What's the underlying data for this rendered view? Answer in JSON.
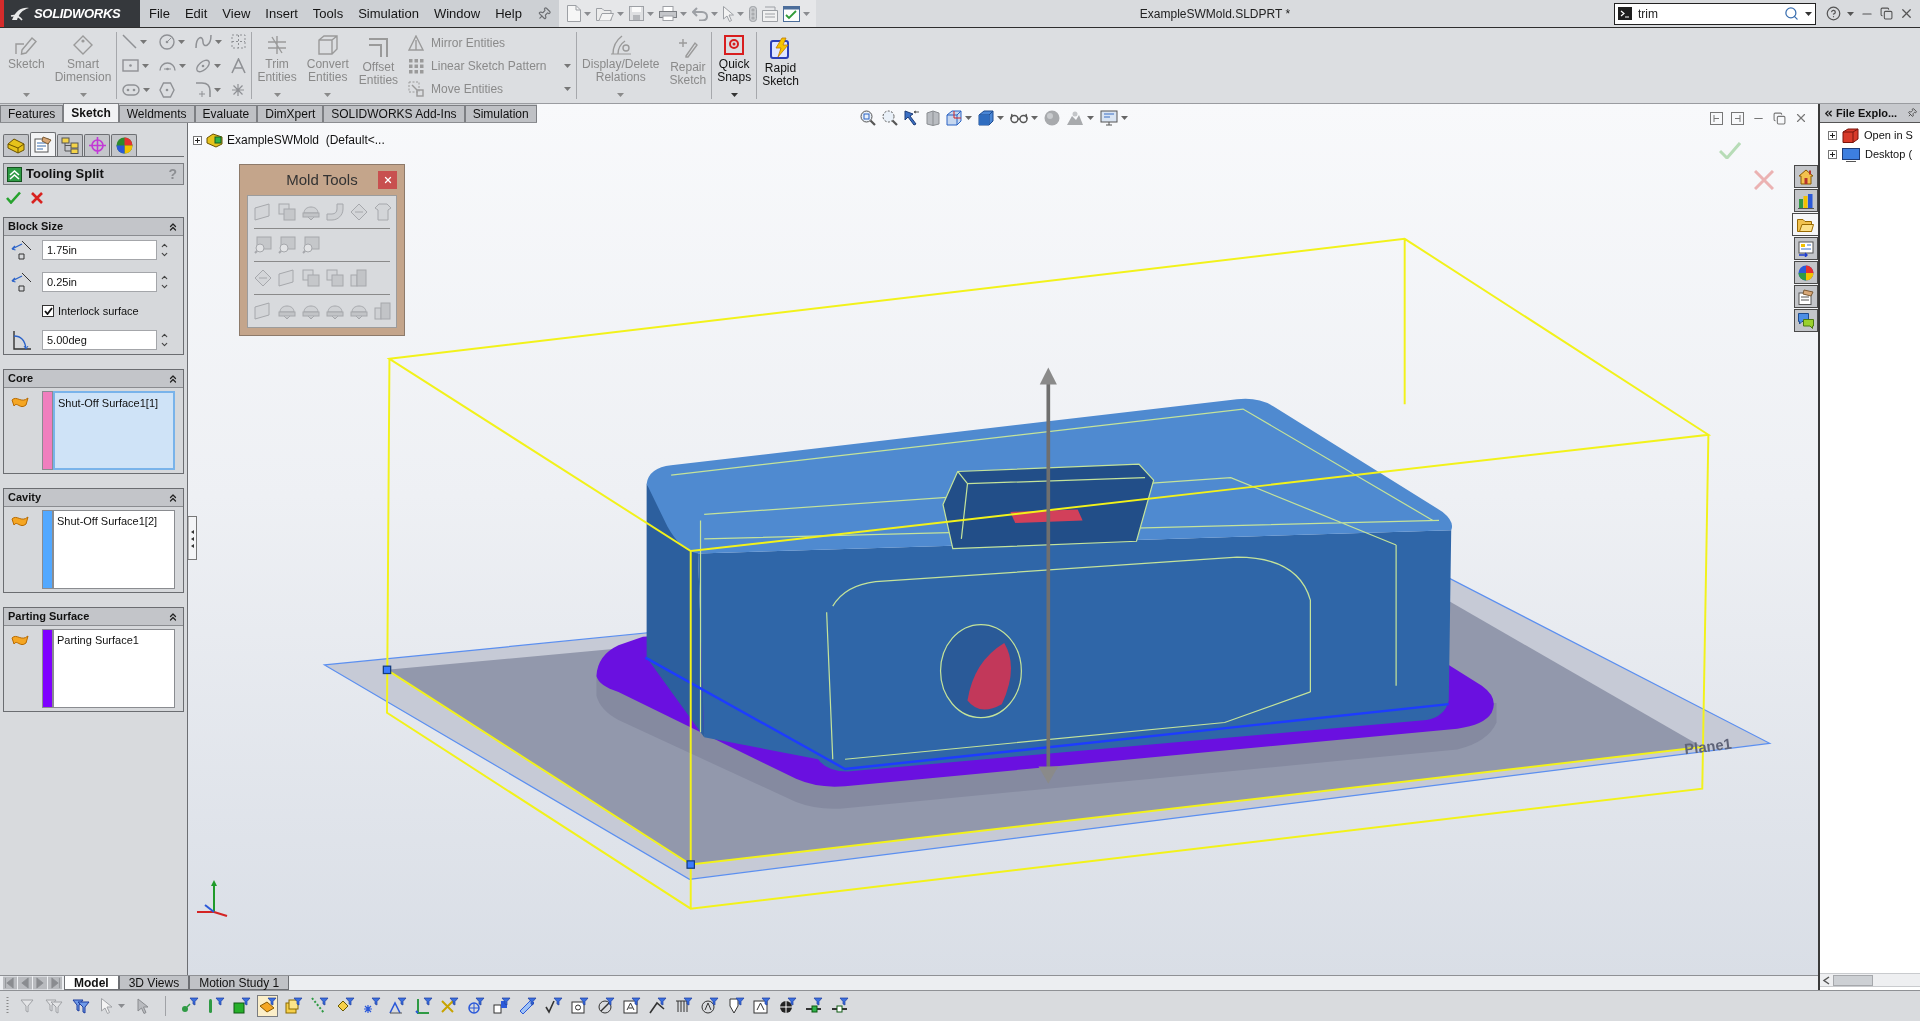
{
  "title_bar": {
    "logo": "SOLIDWORKS",
    "menu": [
      "File",
      "Edit",
      "View",
      "Insert",
      "Tools",
      "Simulation",
      "Window",
      "Help"
    ],
    "document_title": "ExampleSWMold.SLDPRT *",
    "search": {
      "value": "trim"
    }
  },
  "ribbon": {
    "groups": [
      {
        "items": [
          {
            "kind": "large",
            "label": "Sketch",
            "disabled": true,
            "dropdown": true
          },
          {
            "kind": "large",
            "label": "Smart Dimension",
            "disabled": true,
            "dropdown": true
          }
        ]
      },
      {
        "items": [
          {
            "kind": "grid",
            "disabled": true
          }
        ]
      },
      {
        "items": [
          {
            "kind": "large",
            "label": "Trim Entities",
            "disabled": true,
            "dropdown": true
          },
          {
            "kind": "large",
            "label": "Convert Entities",
            "disabled": true,
            "dropdown": true
          },
          {
            "kind": "large",
            "label": "Offset Entities",
            "disabled": true,
            "dropdown": false
          },
          {
            "kind": "stack",
            "rows": [
              {
                "label": "Mirror Entities",
                "disabled": true,
                "dropdown": false
              },
              {
                "label": "Linear Sketch Pattern",
                "disabled": true,
                "dropdown": true
              },
              {
                "label": "Move Entities",
                "disabled": true,
                "dropdown": true
              }
            ]
          }
        ]
      },
      {
        "items": [
          {
            "kind": "large",
            "label": "Display/Delete Relations",
            "disabled": true,
            "dropdown": true
          },
          {
            "kind": "large",
            "label": "Repair Sketch",
            "disabled": true,
            "dropdown": false
          }
        ]
      },
      {
        "items": [
          {
            "kind": "large",
            "label": "Quick Snaps",
            "disabled": false,
            "dropdown": true
          }
        ]
      },
      {
        "items": [
          {
            "kind": "large",
            "label": "Rapid Sketch",
            "disabled": false,
            "dropdown": false
          }
        ]
      }
    ]
  },
  "command_tabs": [
    {
      "label": "Features",
      "selected": false
    },
    {
      "label": "Sketch",
      "selected": true
    },
    {
      "label": "Weldments",
      "selected": false
    },
    {
      "label": "Evaluate",
      "selected": false
    },
    {
      "label": "DimXpert",
      "selected": false
    },
    {
      "label": "SOLIDWORKS Add-Ins",
      "selected": false
    },
    {
      "label": "Simulation",
      "selected": false
    }
  ],
  "property_manager": {
    "tabs": [
      {
        "selected": false
      },
      {
        "selected": true
      },
      {
        "selected": false
      },
      {
        "selected": false
      },
      {
        "selected": false
      }
    ],
    "title": "Tooling Split",
    "help": "?",
    "sections": [
      {
        "kind": "parameters",
        "title": "Block Size",
        "fields": [
          {
            "kind": "depth",
            "value": "1.75in"
          },
          {
            "kind": "depth",
            "value": "0.25in"
          },
          {
            "kind": "checkbox",
            "label": "Interlock surface",
            "checked": true
          },
          {
            "kind": "angle",
            "value": "5.00deg"
          }
        ]
      },
      {
        "kind": "selection",
        "title": "Core",
        "color": "#f07fbe",
        "items": [
          "Shut-Off Surface1[1]"
        ],
        "selected": true
      },
      {
        "kind": "selection",
        "title": "Cavity",
        "color": "#52a8ff",
        "items": [
          "Shut-Off Surface1[2]"
        ],
        "selected": false
      },
      {
        "kind": "selection",
        "title": "Parting Surface",
        "color": "#7f00ff",
        "items": [
          "Parting Surface1"
        ],
        "selected": false
      }
    ]
  },
  "feature_tree": {
    "label": "ExampleSWMold  (Default<...",
    "expanded": false
  },
  "mold_tools": {
    "title": "Mold Tools"
  },
  "viewport": {
    "plane_label": "Plane1"
  },
  "task_pane": {
    "title": "File Explo...",
    "tabs": [
      {
        "selected": false
      },
      {
        "selected": false
      },
      {
        "selected": true
      },
      {
        "selected": false
      },
      {
        "selected": false
      },
      {
        "selected": false
      },
      {
        "selected": false
      }
    ],
    "tree": [
      {
        "label": "Open in S",
        "expanded": false
      },
      {
        "label": "Desktop (",
        "expanded": false
      }
    ]
  },
  "bottom_tabs": [
    {
      "label": "Model",
      "selected": true
    },
    {
      "label": "3D Views",
      "selected": false
    },
    {
      "label": "Motion Study 1",
      "selected": false
    }
  ],
  "selection_filters": [
    {
      "pressed": false
    },
    {
      "pressed": false
    },
    {
      "pressed": false
    },
    {
      "pressed": true
    },
    {
      "pressed": false
    },
    {
      "pressed": false
    },
    {
      "pressed": false
    },
    {
      "pressed": false
    },
    {
      "pressed": false
    },
    {
      "pressed": false
    },
    {
      "pressed": false
    },
    {
      "pressed": false
    },
    {
      "pressed": false
    },
    {
      "pressed": false
    },
    {
      "pressed": false
    },
    {
      "pressed": false
    },
    {
      "pressed": false
    },
    {
      "pressed": false
    },
    {
      "pressed": false
    },
    {
      "pressed": false
    },
    {
      "pressed": false
    },
    {
      "pressed": false
    },
    {
      "pressed": false
    },
    {
      "pressed": false
    },
    {
      "pressed": false
    },
    {
      "pressed": false
    }
  ]
}
